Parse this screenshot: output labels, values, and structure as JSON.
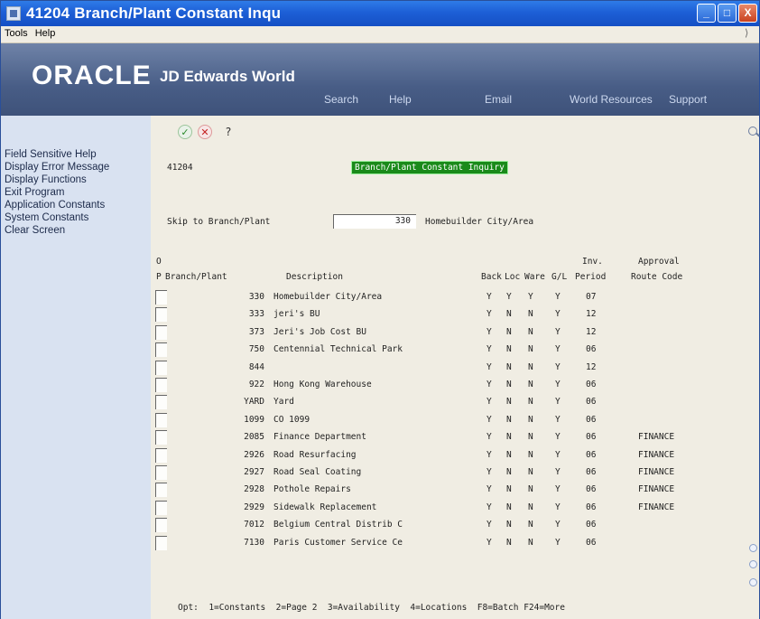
{
  "window": {
    "title": "41204    Branch/Plant Constant Inqu",
    "min_label": "_",
    "max_label": "□",
    "close_label": "X"
  },
  "menubar": {
    "items": [
      "Tools",
      "Help"
    ]
  },
  "banner": {
    "logo": "ORACLE",
    "product": "JD Edwards World",
    "links": [
      "Search",
      "Help",
      "Email",
      "World Resources",
      "Support"
    ]
  },
  "sidebar": {
    "items": [
      "Field Sensitive Help",
      "Display Error Message",
      "Display Functions",
      "Exit Program",
      "Application Constants",
      "System Constants",
      "Clear Screen"
    ]
  },
  "toolbar": {
    "ok": "✓",
    "cancel": "✕",
    "help": "?"
  },
  "form": {
    "program_id": "41204",
    "title": "Branch/Plant Constant Inquiry",
    "skip_label": "Skip to Branch/Plant",
    "skip_value": "330",
    "skip_description": "Homebuilder City/Area"
  },
  "table": {
    "headers": {
      "o_top": "O",
      "p": "P",
      "branch": "Branch/Plant",
      "desc": "Description",
      "back": "Back",
      "loc": "Loc",
      "ware": "Ware",
      "gl": "G/L",
      "inv_top": "Inv.",
      "inv_bottom": "Period",
      "appr_top": "Approval",
      "appr_bottom": "Route Code"
    },
    "rows": [
      {
        "bp": "330",
        "desc": "Homebuilder City/Area",
        "back": "Y",
        "loc": "Y",
        "ware": "Y",
        "gl": "Y",
        "inv": "07",
        "route": ""
      },
      {
        "bp": "333",
        "desc": "jeri's BU",
        "back": "Y",
        "loc": "N",
        "ware": "N",
        "gl": "Y",
        "inv": "12",
        "route": ""
      },
      {
        "bp": "373",
        "desc": "Jeri's Job Cost BU",
        "back": "Y",
        "loc": "N",
        "ware": "N",
        "gl": "Y",
        "inv": "12",
        "route": ""
      },
      {
        "bp": "750",
        "desc": "Centennial Technical Park",
        "back": "Y",
        "loc": "N",
        "ware": "N",
        "gl": "Y",
        "inv": "06",
        "route": ""
      },
      {
        "bp": "844",
        "desc": "",
        "back": "Y",
        "loc": "N",
        "ware": "N",
        "gl": "Y",
        "inv": "12",
        "route": ""
      },
      {
        "bp": "922",
        "desc": "Hong Kong Warehouse",
        "back": "Y",
        "loc": "N",
        "ware": "N",
        "gl": "Y",
        "inv": "06",
        "route": ""
      },
      {
        "bp": "YARD",
        "desc": "Yard",
        "back": "Y",
        "loc": "N",
        "ware": "N",
        "gl": "Y",
        "inv": "06",
        "route": ""
      },
      {
        "bp": "1099",
        "desc": "CO 1099",
        "back": "Y",
        "loc": "N",
        "ware": "N",
        "gl": "Y",
        "inv": "06",
        "route": ""
      },
      {
        "bp": "2085",
        "desc": "Finance Department",
        "back": "Y",
        "loc": "N",
        "ware": "N",
        "gl": "Y",
        "inv": "06",
        "route": "FINANCE"
      },
      {
        "bp": "2926",
        "desc": "Road Resurfacing",
        "back": "Y",
        "loc": "N",
        "ware": "N",
        "gl": "Y",
        "inv": "06",
        "route": "FINANCE"
      },
      {
        "bp": "2927",
        "desc": "Road Seal Coating",
        "back": "Y",
        "loc": "N",
        "ware": "N",
        "gl": "Y",
        "inv": "06",
        "route": "FINANCE"
      },
      {
        "bp": "2928",
        "desc": "Pothole Repairs",
        "back": "Y",
        "loc": "N",
        "ware": "N",
        "gl": "Y",
        "inv": "06",
        "route": "FINANCE"
      },
      {
        "bp": "2929",
        "desc": "Sidewalk Replacement",
        "back": "Y",
        "loc": "N",
        "ware": "N",
        "gl": "Y",
        "inv": "06",
        "route": "FINANCE"
      },
      {
        "bp": "7012",
        "desc": "Belgium Central Distrib C",
        "back": "Y",
        "loc": "N",
        "ware": "N",
        "gl": "Y",
        "inv": "06",
        "route": ""
      },
      {
        "bp": "7130",
        "desc": "Paris Customer Service Ce",
        "back": "Y",
        "loc": "N",
        "ware": "N",
        "gl": "Y",
        "inv": "06",
        "route": ""
      }
    ]
  },
  "footer": {
    "options": "Opt:  1=Constants  2=Page 2  3=Availability  4=Locations  F8=Batch F24=More"
  }
}
